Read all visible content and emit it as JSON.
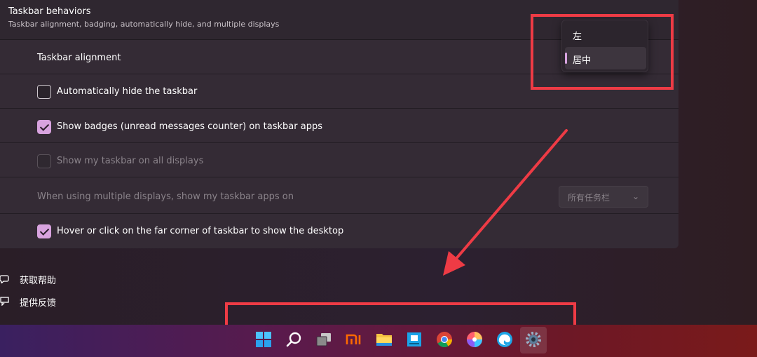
{
  "header": {
    "title": "Taskbar behaviors",
    "subtitle": "Taskbar alignment, badging, automatically hide, and multiple displays"
  },
  "settings": {
    "alignment_label": "Taskbar alignment",
    "auto_hide": {
      "label": "Automatically hide the taskbar",
      "checked": false
    },
    "badges": {
      "label": "Show badges (unread messages counter) on taskbar apps",
      "checked": true
    },
    "all_displays": {
      "label": "Show my taskbar on all displays",
      "checked": false,
      "disabled": true
    },
    "multi_display": {
      "label": "When using multiple displays, show my taskbar apps on",
      "value": "所有任务栏"
    },
    "corner_desktop": {
      "label": "Hover or click on the far corner of taskbar to show the desktop",
      "checked": true
    }
  },
  "alignment_menu": {
    "options": [
      "左",
      "居中"
    ],
    "selected": "居中"
  },
  "links": {
    "help": "获取帮助",
    "feedback": "提供反馈"
  },
  "taskbar": {
    "icons": [
      "windows-start-icon",
      "search-icon",
      "task-view-icon",
      "mi-icon",
      "file-explorer-icon",
      "store-icon",
      "chrome-icon",
      "photos-icon",
      "edge-icon",
      "settings-gear-icon"
    ]
  },
  "colors": {
    "accent": "#d8a3df",
    "annotation": "#ee3b45"
  }
}
